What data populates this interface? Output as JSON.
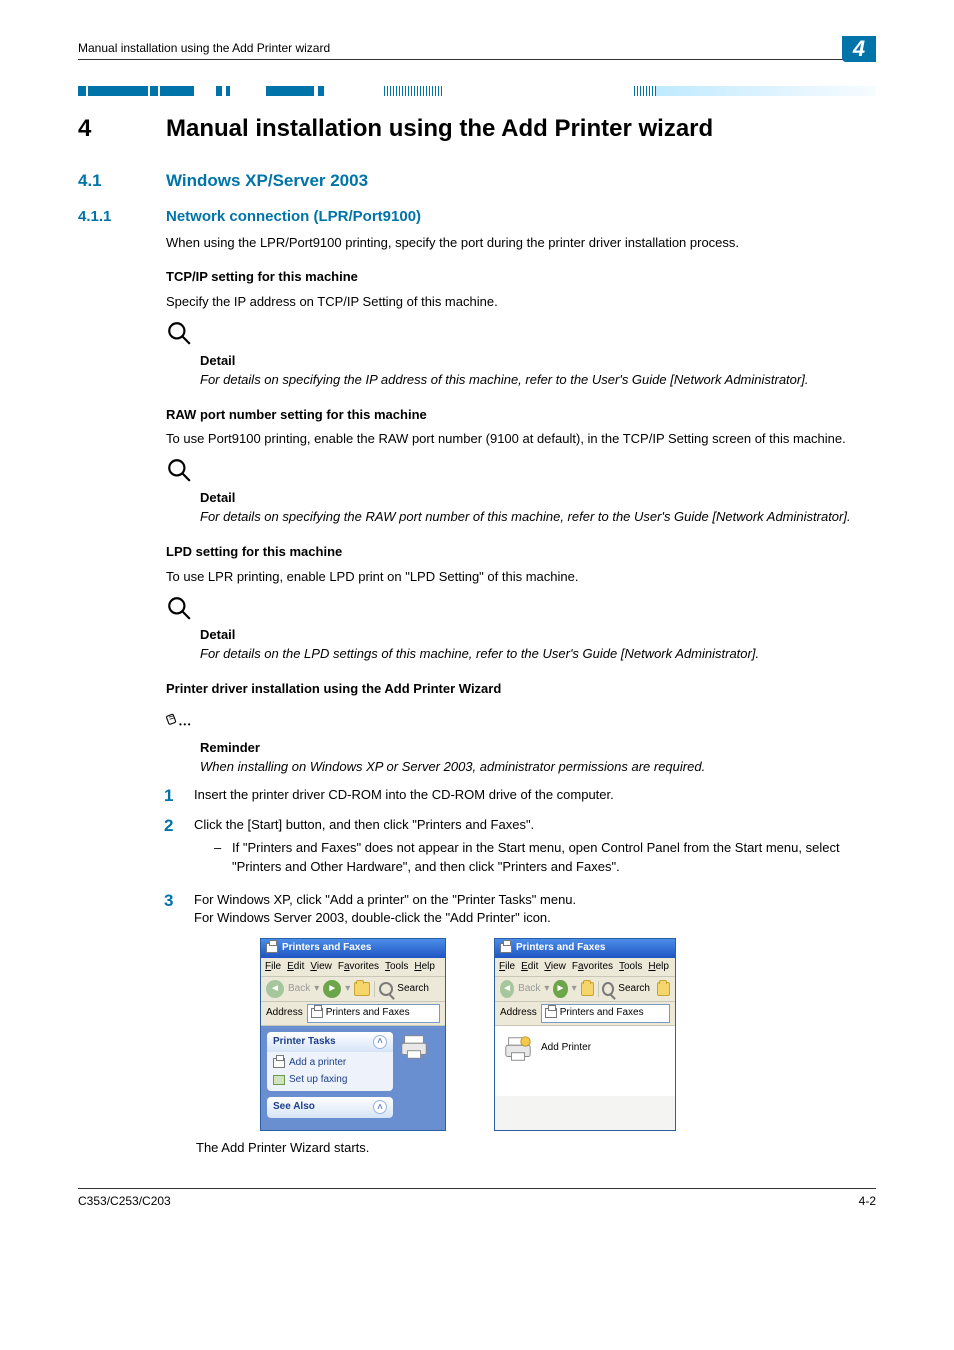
{
  "header": {
    "running_title": "Manual installation using the Add Printer wizard",
    "page_badge": "4"
  },
  "chapter": {
    "number": "4",
    "title": "Manual installation using the Add Printer wizard"
  },
  "sec1": {
    "number": "4.1",
    "title": "Windows XP/Server 2003"
  },
  "sub1": {
    "number": "4.1.1",
    "title": "Network connection (LPR/Port9100)"
  },
  "p_intro": "When using the LPR/Port9100 printing, specify the port during the printer driver installation process.",
  "h_tcpip": "TCP/IP setting for this machine",
  "p_tcpip": "Specify the IP address on TCP/IP Setting of this machine.",
  "detail1": {
    "label": "Detail",
    "text": "For details on specifying the IP address of this machine, refer to the User's Guide [Network Administrator]."
  },
  "h_raw": "RAW port number setting for this machine",
  "p_raw": "To use Port9100 printing, enable the RAW port number (9100 at default), in the TCP/IP Setting screen of this machine.",
  "detail2": {
    "label": "Detail",
    "text": "For details on specifying the RAW port number of this machine, refer to the User's Guide [Network Administrator]."
  },
  "h_lpd": "LPD setting for this machine",
  "p_lpd": "To use LPR printing, enable LPD print on \"LPD Setting\" of this machine.",
  "detail3": {
    "label": "Detail",
    "text": "For details on the LPD settings of this machine, refer to the User's Guide [Network Administrator]."
  },
  "h_install": "Printer driver installation using the Add Printer Wizard",
  "reminder": {
    "label": "Reminder",
    "text": "When installing on Windows XP or Server 2003, administrator permissions are required."
  },
  "step1": "Insert the printer driver CD-ROM into the CD-ROM drive of the computer.",
  "step2": "Click the [Start] button, and then click \"Printers and Faxes\".",
  "step2sub": "If \"Printers and Faxes\" does not appear in the Start menu, open Control Panel from the Start menu, select \"Printers and Other Hardware\", and then click \"Printers and Faxes\".",
  "step3a": "For Windows XP, click \"Add a printer\" on the \"Printer Tasks\" menu.",
  "step3b": "For Windows Server 2003, double-click the \"Add Printer\" icon.",
  "p_after": "The Add Printer Wizard starts.",
  "win": {
    "title": "Printers and Faxes",
    "file": "File",
    "edit": "Edit",
    "view": "View",
    "fav": "Favorites",
    "tools": "Tools",
    "help": "Help",
    "back": "Back",
    "search": "Search",
    "address_label": "Address",
    "address_value": "Printers and Faxes",
    "ptasks": "Printer Tasks",
    "add_printer_link": "Add a printer",
    "setup_faxing": "Set up faxing",
    "see_also": "See Also",
    "add_printer_icon": "Add Printer"
  },
  "footer": {
    "left": "C353/C253/C203",
    "right": "4-2"
  }
}
